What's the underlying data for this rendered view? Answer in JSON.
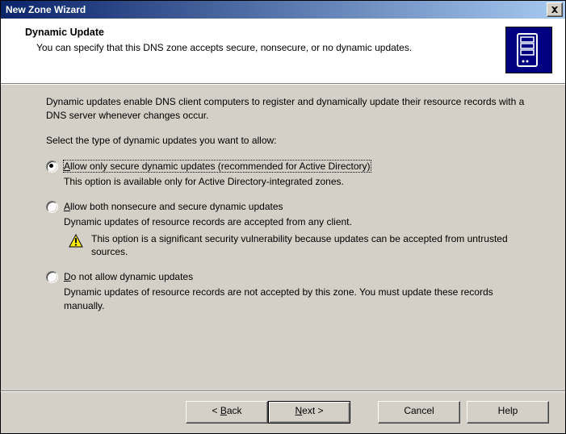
{
  "titlebar": {
    "title": "New Zone Wizard"
  },
  "header": {
    "title": "Dynamic Update",
    "desc": "You can specify that this DNS zone accepts secure, nonsecure, or no dynamic updates."
  },
  "body": {
    "intro1": "Dynamic updates enable DNS client computers to register and dynamically update their resource records with a DNS server whenever changes occur.",
    "intro2": "Select the type of dynamic updates you want to allow:"
  },
  "options": {
    "secure": {
      "label_rest": "llow only secure dynamic updates (recommended for Active Directory)",
      "desc": "This option is available only for Active Directory-integrated zones."
    },
    "both": {
      "label_rest": "llow both nonsecure and secure dynamic updates",
      "desc": "Dynamic updates of resource records are accepted from any client.",
      "warn": "This option is a significant security vulnerability because updates can be accepted from untrusted sources."
    },
    "none": {
      "label_rest": "o not allow dynamic updates",
      "desc": "Dynamic updates of resource records are not accepted by this zone. You must update these records manually."
    }
  },
  "buttons": {
    "back_rest": "ack",
    "next_rest": "ext >",
    "cancel": "Cancel",
    "help": "Help"
  }
}
